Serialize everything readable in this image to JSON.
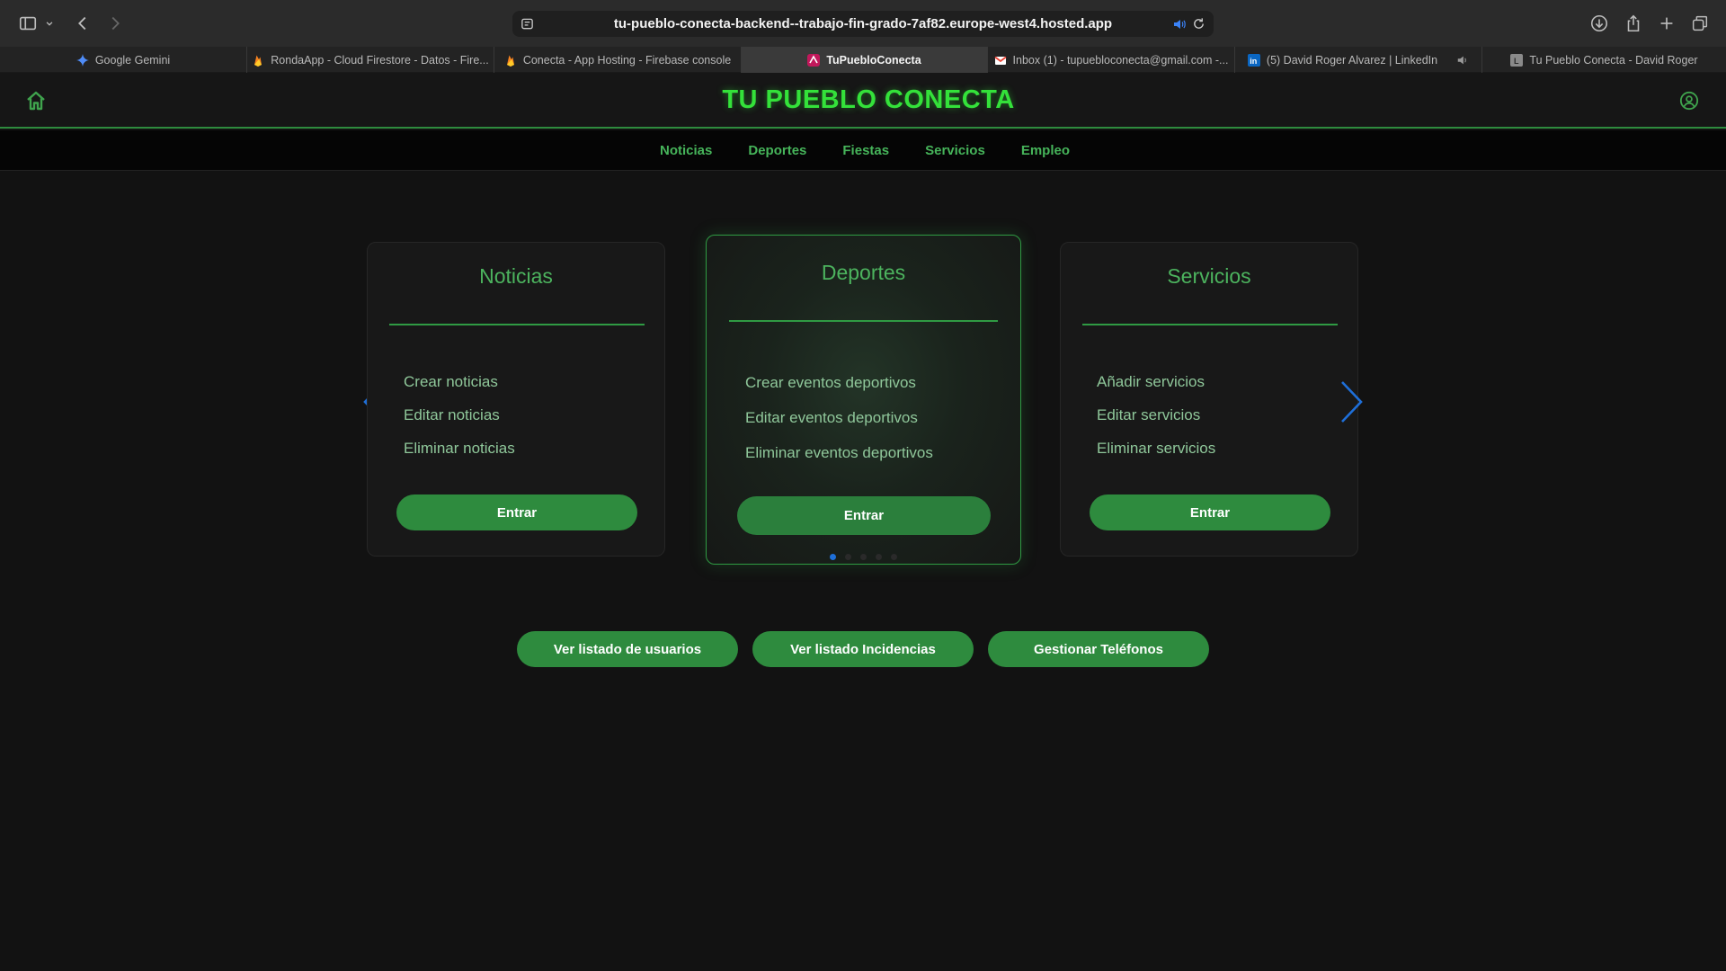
{
  "browser": {
    "url": "tu-pueblo-conecta-backend--trabajo-fin-grado-7af82.europe-west4.hosted.app",
    "tabs": [
      {
        "label": "Google Gemini",
        "icon": "gemini-icon",
        "active": false
      },
      {
        "label": "RondaApp - Cloud Firestore - Datos - Fire...",
        "icon": "firebase-icon",
        "active": false
      },
      {
        "label": "Conecta - App Hosting - Firebase console",
        "icon": "firebase-icon",
        "active": false
      },
      {
        "label": "TuPuebloConecta",
        "icon": "app-icon",
        "active": true
      },
      {
        "label": "Inbox (1) - tupuebloconecta@gmail.com -...",
        "icon": "gmail-icon",
        "active": false
      },
      {
        "label": "(5) David Roger Alvarez | LinkedIn",
        "icon": "linkedin-icon",
        "active": false
      },
      {
        "label": "Tu Pueblo Conecta - David Roger",
        "icon": "page-icon",
        "active": false
      }
    ]
  },
  "header": {
    "brand": "TU PUEBLO CONECTA"
  },
  "nav": {
    "items": [
      "Noticias",
      "Deportes",
      "Fiestas",
      "Servicios",
      "Empleo"
    ]
  },
  "carousel": {
    "cards": [
      {
        "title": "Noticias",
        "options": [
          "Crear noticias",
          "Editar noticias",
          "Eliminar noticias"
        ],
        "button": "Entrar"
      },
      {
        "title": "Deportes",
        "options": [
          "Crear eventos deportivos",
          "Editar eventos deportivos",
          "Eliminar eventos deportivos"
        ],
        "button": "Entrar"
      },
      {
        "title": "Servicios",
        "options": [
          "Añadir servicios",
          "Editar servicios",
          "Eliminar servicios"
        ],
        "button": "Entrar"
      }
    ],
    "active_index": 1,
    "dot_count": 5
  },
  "actions": {
    "users": "Ver listado de usuarios",
    "incidents": "Ver listado Incidencias",
    "phones": "Gestionar Teléfonos"
  },
  "colors": {
    "accent_green": "#2e8b3e",
    "brand_green": "#34e13a",
    "arrow_blue": "#1e6fd9",
    "background": "#121212"
  }
}
